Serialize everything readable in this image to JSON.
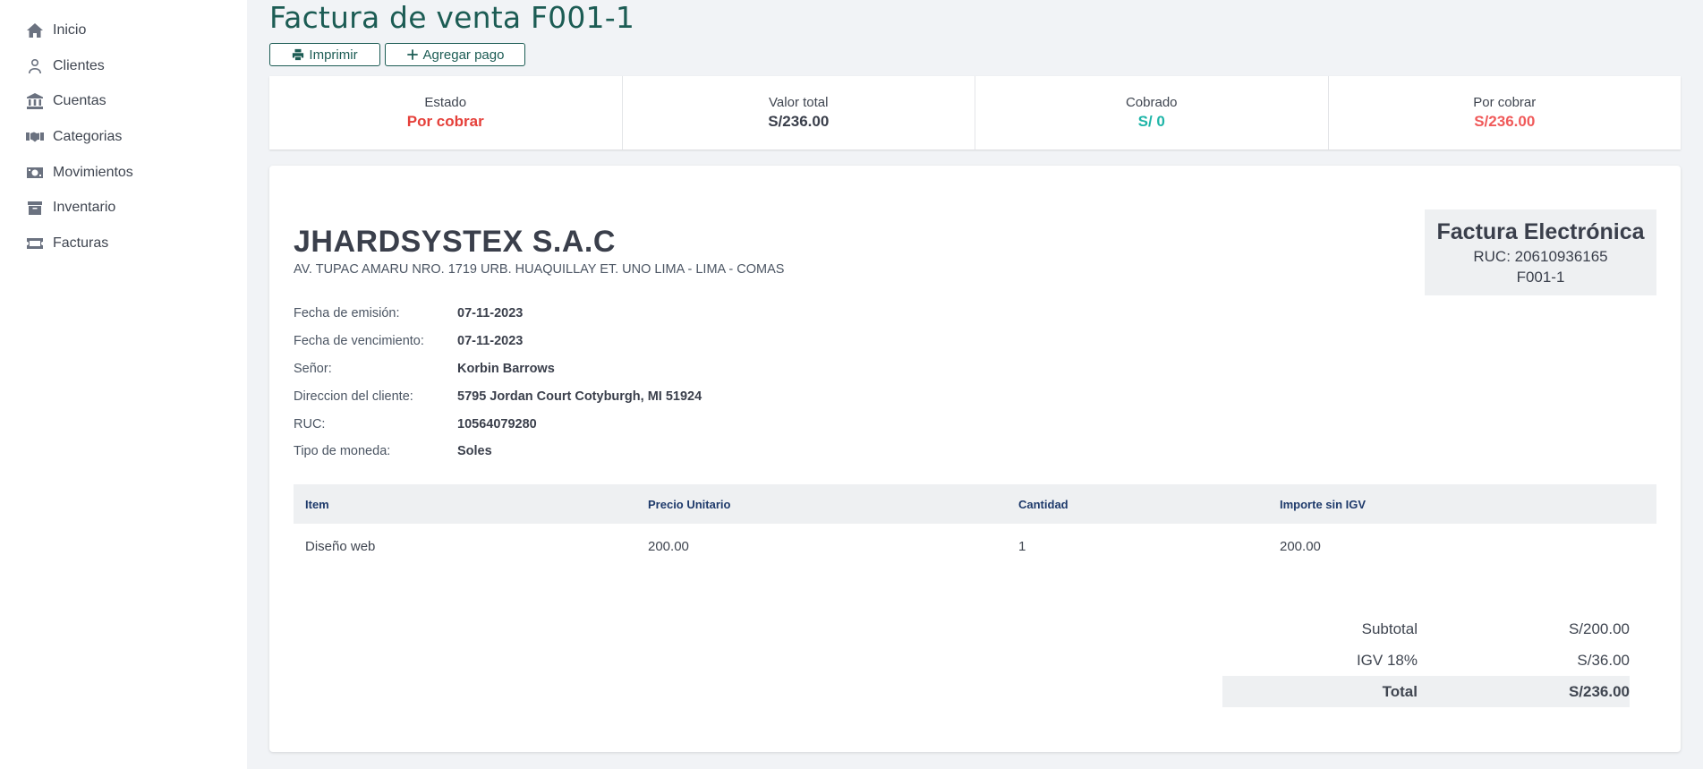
{
  "sidebar": {
    "items": [
      {
        "label": "Inicio",
        "icon": "home-icon"
      },
      {
        "label": "Clientes",
        "icon": "user-icon"
      },
      {
        "label": "Cuentas",
        "icon": "bank-icon"
      },
      {
        "label": "Categorias",
        "icon": "handshake-icon"
      },
      {
        "label": "Movimientos",
        "icon": "money-icon"
      },
      {
        "label": "Inventario",
        "icon": "box-icon"
      },
      {
        "label": "Facturas",
        "icon": "ticket-icon"
      }
    ]
  },
  "header": {
    "title": "Factura de venta F001-1",
    "print_label": "Imprimir",
    "add_payment_label": "Agregar pago"
  },
  "stats": [
    {
      "label": "Estado",
      "value": "Por cobrar",
      "color": "#e5403a"
    },
    {
      "label": "Valor total",
      "value": "S/236.00",
      "color": "#3a3f4b"
    },
    {
      "label": "Cobrado",
      "value": "S/ 0",
      "color": "#1fb5a8"
    },
    {
      "label": "Por cobrar",
      "value": "S/236.00",
      "color": "#f05a5a"
    }
  ],
  "invoice": {
    "company_name": "JHARDSYSTEX S.A.C",
    "company_address": "AV. TUPAC AMARU NRO. 1719 URB. HUAQUILLAY ET. UNO LIMA - LIMA - COMAS",
    "doc_title": "Factura Electrónica",
    "doc_ruc": "RUC: 20610936165",
    "doc_number": "F001-1",
    "fields": [
      {
        "label": "Fecha de emisión:",
        "value": "07-11-2023"
      },
      {
        "label": "Fecha de vencimiento:",
        "value": "07-11-2023"
      },
      {
        "label": "Señor:",
        "value": "Korbin Barrows"
      },
      {
        "label": "Direccion del cliente:",
        "value": "5795 Jordan Court Cotyburgh, MI 51924"
      },
      {
        "label": "RUC:",
        "value": "10564079280"
      },
      {
        "label": "Tipo de moneda:",
        "value": "Soles"
      }
    ],
    "table": {
      "headers": [
        "Item",
        "Precio Unitario",
        "Cantidad",
        "Importe sin IGV"
      ],
      "rows": [
        [
          "Diseño web",
          "200.00",
          "1",
          "200.00"
        ]
      ]
    },
    "totals": [
      {
        "label": "Subtotal",
        "value": "S/200.00"
      },
      {
        "label": "IGV 18%",
        "value": "S/36.00"
      },
      {
        "label": "Total",
        "value": "S/236.00"
      }
    ]
  }
}
